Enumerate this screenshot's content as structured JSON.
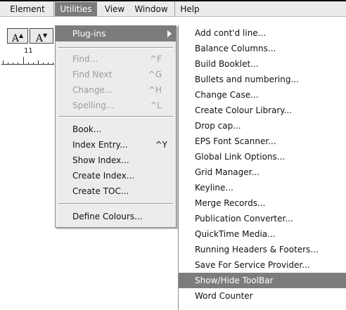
{
  "menubar": {
    "items": [
      {
        "label": "Element",
        "active": false
      },
      {
        "label": "Utilities",
        "active": true
      },
      {
        "label": "View",
        "active": false
      },
      {
        "label": "Window",
        "active": false
      },
      {
        "label": "Help",
        "active": false
      }
    ]
  },
  "toolbar": {
    "font_up_label": "A",
    "font_down_label": "A",
    "ruler_number": "11"
  },
  "utilities_menu": {
    "plugins": {
      "label": "Plug-ins",
      "highlighted": true,
      "has_submenu": true
    },
    "group_find": [
      {
        "label": "Find...",
        "shortcut": "^F",
        "enabled": false
      },
      {
        "label": "Find Next",
        "shortcut": "^G",
        "enabled": false
      },
      {
        "label": "Change...",
        "shortcut": "^H",
        "enabled": false
      },
      {
        "label": "Spelling...",
        "shortcut": "^L",
        "enabled": false
      }
    ],
    "group_book": [
      {
        "label": "Book...",
        "shortcut": "",
        "enabled": true
      },
      {
        "label": "Index Entry...",
        "shortcut": "^Y",
        "enabled": true
      },
      {
        "label": "Show Index...",
        "shortcut": "",
        "enabled": true
      },
      {
        "label": "Create Index...",
        "shortcut": "",
        "enabled": true
      },
      {
        "label": "Create TOC...",
        "shortcut": "",
        "enabled": true
      }
    ],
    "define_colours": {
      "label": "Define Colours...",
      "enabled": true
    }
  },
  "plugins_submenu": {
    "items": [
      "Add cont'd line...",
      "Balance Columns...",
      "Build Booklet...",
      "Bullets and numbering...",
      "Change Case...",
      "Create Colour Library...",
      "Drop cap...",
      "EPS Font Scanner...",
      "Global Link Options...",
      "Grid Manager...",
      "Keyline...",
      "Merge Records...",
      "Publication Converter...",
      "QuickTime Media...",
      "Running Headers & Footers...",
      "Save For Service Provider...",
      "Show/Hide ToolBar",
      "Word Counter"
    ],
    "highlighted_index": 16
  },
  "colors": {
    "menubar_bg": "#ebebeb",
    "highlight_bg": "#7c7c7c",
    "disabled_text": "#9b9b9b"
  }
}
